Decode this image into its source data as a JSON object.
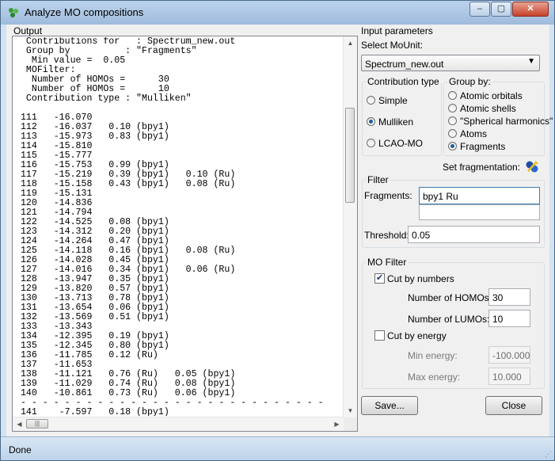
{
  "window": {
    "title": "Analyze MO compositions",
    "controls": [
      "–",
      "▢",
      "✕"
    ]
  },
  "output": {
    "label": "Output",
    "lines": [
      "  Contributions for   : Spectrum_new.out",
      "  Group by          : \"Fragments\"",
      "   Min value =  0.05",
      "  MOFilter:",
      "   Number of HOMOs =      30",
      "   Number of HOMOs =      10",
      "  Contribution type : \"Mulliken\"",
      "",
      " 111   -16.070",
      " 112   -16.037   0.10 (bpy1)",
      " 113   -15.973   0.83 (bpy1)",
      " 114   -15.810",
      " 115   -15.777",
      " 116   -15.753   0.99 (bpy1)",
      " 117   -15.219   0.39 (bpy1)   0.10 (Ru)",
      " 118   -15.158   0.43 (bpy1)   0.08 (Ru)",
      " 119   -15.131",
      " 120   -14.836",
      " 121   -14.794",
      " 122   -14.525   0.08 (bpy1)",
      " 123   -14.312   0.20 (bpy1)",
      " 124   -14.264   0.47 (bpy1)",
      " 125   -14.118   0.16 (bpy1)   0.08 (Ru)",
      " 126   -14.028   0.45 (bpy1)",
      " 127   -14.016   0.34 (bpy1)   0.06 (Ru)",
      " 128   -13.947   0.35 (bpy1)",
      " 129   -13.820   0.57 (bpy1)",
      " 130   -13.713   0.78 (bpy1)",
      " 131   -13.654   0.06 (bpy1)",
      " 132   -13.569   0.51 (bpy1)",
      " 133   -13.343",
      " 134   -12.395   0.19 (bpy1)",
      " 135   -12.345   0.80 (bpy1)",
      " 136   -11.785   0.12 (Ru)",
      " 137   -11.653",
      " 138   -11.121   0.76 (Ru)   0.05 (bpy1)",
      " 139   -11.029   0.74 (Ru)   0.08 (bpy1)",
      " 140   -10.861   0.73 (Ru)   0.06 (bpy1)",
      " - - - - - - - - - - - - - - - - - - - - - - - - - - - -",
      " 141    -7.597   0.18 (bpy1)"
    ]
  },
  "input": {
    "label": "Input parameters",
    "select_label": "Select MoUnit:",
    "select_value": "Spectrum_new.out",
    "contribution": {
      "title": "Contribution type",
      "options": [
        "Simple",
        "Mulliken",
        "LCAO-MO"
      ],
      "selected": "Mulliken"
    },
    "group_by": {
      "title": "Group by:",
      "options": [
        "Atomic orbitals",
        "Atomic shells",
        "\"Spherical harmonics\"",
        "Atoms",
        "Fragments"
      ],
      "selected": "Fragments"
    },
    "set_fragmentation": "Set fragmentation:"
  },
  "filter": {
    "title": "Filter",
    "fragments_label": "Fragments:",
    "fragments_value": "bpy1 Ru",
    "threshold_label": "Threshold:",
    "threshold_value": "0.05"
  },
  "mo_filter": {
    "title": "MO Filter",
    "cut_by_numbers": "Cut by numbers",
    "cut_by_numbers_checked": true,
    "homos_label": "Number of HOMOs:",
    "homos_value": "30",
    "lumos_label": "Number of LUMOs:",
    "lumos_value": "10",
    "cut_by_energy": "Cut by energy",
    "cut_by_energy_checked": false,
    "min_energy_label": "Min energy:",
    "min_energy_value": "-100.000",
    "max_energy_label": "Max energy:",
    "max_energy_value": "10.000"
  },
  "buttons": {
    "save": "Save...",
    "close": "Close"
  },
  "status": "Done"
}
